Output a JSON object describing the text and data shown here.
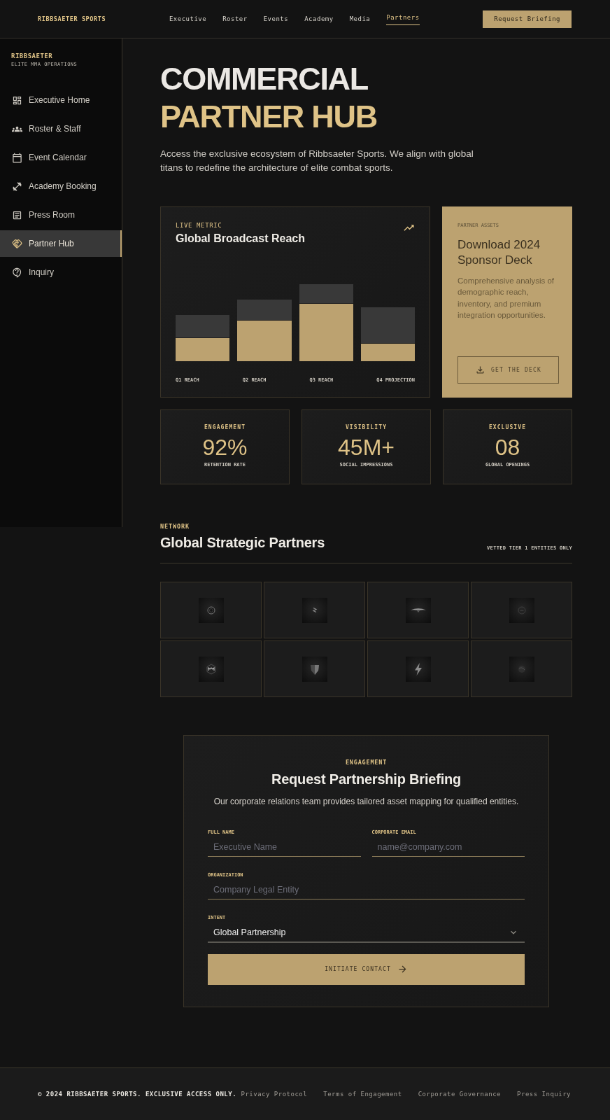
{
  "header": {
    "brand": "RIBBSAETER SPORTS",
    "nav": [
      {
        "label": "Executive",
        "selected": false
      },
      {
        "label": "Roster",
        "selected": false
      },
      {
        "label": "Events",
        "selected": false
      },
      {
        "label": "Academy",
        "selected": false
      },
      {
        "label": "Media",
        "selected": false
      },
      {
        "label": "Partners",
        "selected": true
      }
    ],
    "cta": "Request Briefing"
  },
  "sidebar": {
    "title": "RIBBSAETER",
    "subtitle": "ELITE MMA OPERATIONS",
    "items": [
      {
        "label": "Executive Home",
        "selected": false
      },
      {
        "label": "Roster & Staff",
        "selected": false
      },
      {
        "label": "Event Calendar",
        "selected": false
      },
      {
        "label": "Academy Booking",
        "selected": false
      },
      {
        "label": "Press Room",
        "selected": false
      },
      {
        "label": "Partner Hub",
        "selected": true
      },
      {
        "label": "Inquiry",
        "selected": false
      }
    ]
  },
  "hero": {
    "title": "COMMERCIAL",
    "title_accent": "PARTNER HUB",
    "intro": "Access the exclusive ecosystem of Ribbsaeter Sports. We align with global titans to redefine the architecture of elite combat sports."
  },
  "broadcast_card": {
    "eyebrow": "LIVE METRIC",
    "title": "Global Broadcast Reach",
    "bar_labels": [
      "Q1 REACH",
      "Q2 REACH",
      "Q3 REACH",
      "Q4 PROJECTION"
    ]
  },
  "deck_card": {
    "eyebrow": "PARTNER ASSETS",
    "title": "Download 2024 Sponsor Deck",
    "description": "Comprehensive analysis of demographic reach, inventory, and premium integration opportunities.",
    "button": "GET THE DECK"
  },
  "stats": [
    {
      "label": "ENGAGEMENT",
      "value": "92%",
      "caption": "RETENTION RATE"
    },
    {
      "label": "VISIBILITY",
      "value": "45M+",
      "caption": "SOCIAL IMPRESSIONS"
    },
    {
      "label": "EXCLUSIVE",
      "value": "08",
      "caption": "GLOBAL OPENINGS"
    }
  ],
  "network": {
    "eyebrow": "NETWORK",
    "title": "Global Strategic Partners",
    "note": "VETTED TIER 1 ENTITIES ONLY",
    "partners": [
      {
        "kind": "ring"
      },
      {
        "kind": "zigzag"
      },
      {
        "kind": "wings"
      },
      {
        "kind": "badge"
      },
      {
        "kind": "hexagon"
      },
      {
        "kind": "shield"
      },
      {
        "kind": "lightning"
      },
      {
        "kind": "orb"
      }
    ]
  },
  "briefing_form": {
    "eyebrow": "ENGAGEMENT",
    "title": "Request Partnership Briefing",
    "subtitle": "Our corporate relations team provides tailored asset mapping for qualified entities.",
    "rows": [
      [
        {
          "kind": "input",
          "label": "FULL NAME",
          "placeholder": "Executive Name"
        },
        {
          "kind": "input",
          "label": "CORPORATE EMAIL",
          "placeholder": "name@company.com"
        }
      ],
      [
        {
          "kind": "input",
          "label": "ORGANIZATION",
          "placeholder": "Company Legal Entity"
        }
      ],
      [
        {
          "kind": "select",
          "label": "INTENT",
          "value": "Global Partnership"
        }
      ]
    ],
    "submit": "INITIATE CONTACT"
  },
  "footer": {
    "copyright": "© 2024 RIBBSAETER SPORTS. EXCLUSIVE ACCESS ONLY.",
    "links": [
      "Privacy Protocol",
      "Terms of Engagement",
      "Corporate Governance",
      "Press Inquiry"
    ]
  }
}
